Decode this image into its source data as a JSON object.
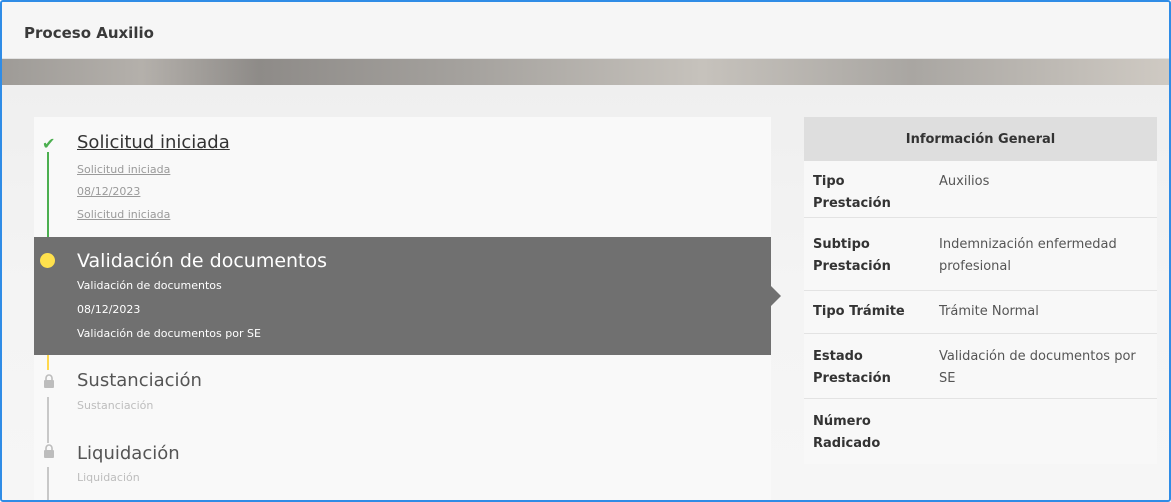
{
  "page": {
    "title": "Proceso Auxilio"
  },
  "timeline": {
    "steps": [
      {
        "title": "Solicitud iniciada",
        "lines": [
          "Solicitud iniciada",
          "08/12/2023",
          "Solicitud iniciada"
        ],
        "status": "done"
      },
      {
        "title": "Validación de documentos",
        "lines": [
          "Validación de documentos",
          "08/12/2023",
          "Validación de documentos por SE"
        ],
        "status": "active"
      },
      {
        "title": "Sustanciación",
        "lines": [
          "Sustanciación"
        ],
        "status": "pending"
      },
      {
        "title": "Liquidación",
        "lines": [
          "Liquidación"
        ],
        "status": "pending"
      }
    ]
  },
  "info": {
    "header": "Información General",
    "rows": [
      {
        "label": "Tipo Prestación",
        "value": "Auxilios"
      },
      {
        "label": "Subtipo Prestación",
        "value": "Indemnización enfermedad profesional"
      },
      {
        "label": "Tipo Trámite",
        "value": "Trámite Normal"
      },
      {
        "label": "Estado Prestación",
        "value": "Validación de documentos por SE"
      },
      {
        "label": "Número Radicado",
        "value": ""
      }
    ]
  },
  "colors": {
    "frame_border": "#2f8ce6",
    "done": "#4caf50",
    "active_bg": "#707070",
    "active_dot": "#ffe14d",
    "pending_line": "#c8c8c8"
  },
  "icons": {
    "done": "check-icon",
    "active": "current-step-dot-icon",
    "pending": "lock-icon"
  }
}
